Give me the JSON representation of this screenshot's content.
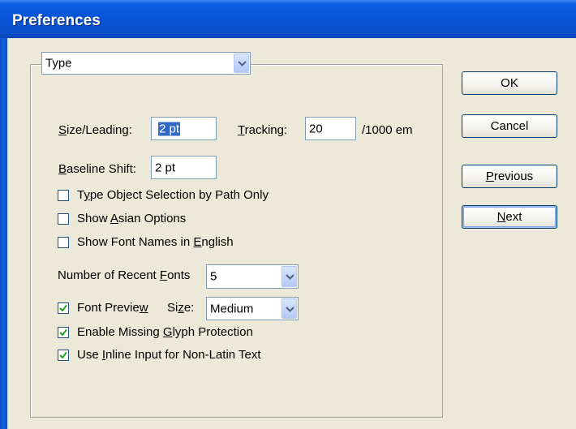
{
  "window": {
    "title": "Preferences"
  },
  "section_select": {
    "value": "Type"
  },
  "size_leading": {
    "label_prefix": "",
    "label_mnemonic": "S",
    "label_rest": "ize/Leading:",
    "value": "2 pt"
  },
  "tracking": {
    "label_mnemonic": "T",
    "label_rest": "racking:",
    "value": "20",
    "unit": "/1000 em"
  },
  "baseline_shift": {
    "label_mnemonic": "B",
    "label_rest": "aseline Shift:",
    "value": "2 pt"
  },
  "options": [
    {
      "pre": "T",
      "mn": "y",
      "post": "pe Object Selection by Path Only",
      "checked": false
    },
    {
      "pre": "Show ",
      "mn": "A",
      "post": "sian Options",
      "checked": false
    },
    {
      "pre": "Show Font Names in ",
      "mn": "E",
      "post": "nglish",
      "checked": false
    }
  ],
  "recent_fonts": {
    "label_pre": "Number of Recent ",
    "label_mn": "F",
    "label_post": "onts",
    "value": "5"
  },
  "font_preview": {
    "pre": "Font Previe",
    "mn": "w",
    "post": "",
    "checked": true,
    "size_pre": "Si",
    "size_mn": "z",
    "size_post": "e:",
    "size_value": "Medium"
  },
  "options2": [
    {
      "pre": "Enable Missing ",
      "mn": "G",
      "post": "lyph Protection",
      "checked": true
    },
    {
      "pre": "Use ",
      "mn": "I",
      "post": "nline Input for Non-Latin Text",
      "checked": true
    }
  ],
  "buttons": {
    "ok": "OK",
    "cancel": "Cancel",
    "previous_mn": "P",
    "previous_rest": "revious",
    "next_mn": "N",
    "next_rest": "ext"
  }
}
